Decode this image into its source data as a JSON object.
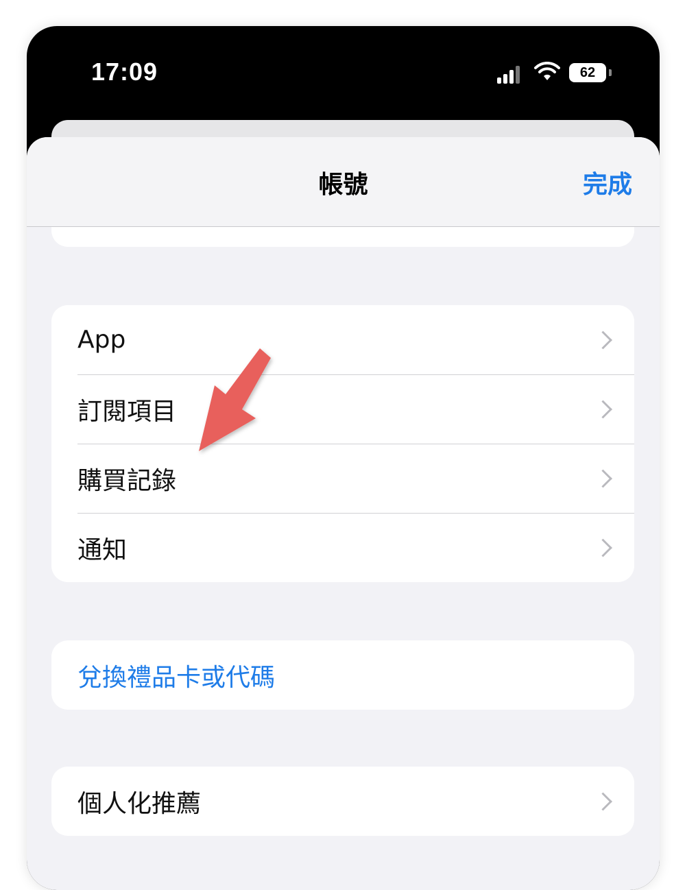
{
  "status_bar": {
    "time": "17:09",
    "battery": "62"
  },
  "nav": {
    "title": "帳號",
    "done_label": "完成"
  },
  "groups": [
    {
      "rows": [
        {
          "label": "App"
        },
        {
          "label": "訂閱項目"
        },
        {
          "label": "購買記錄"
        },
        {
          "label": "通知"
        }
      ]
    },
    {
      "rows": [
        {
          "label": "兌換禮品卡或代碼"
        }
      ]
    },
    {
      "rows": [
        {
          "label": "個人化推薦"
        }
      ]
    }
  ],
  "colors": {
    "accent": "#1e7ce8",
    "arrow": "#e8605c",
    "background": "#f2f2f6"
  }
}
